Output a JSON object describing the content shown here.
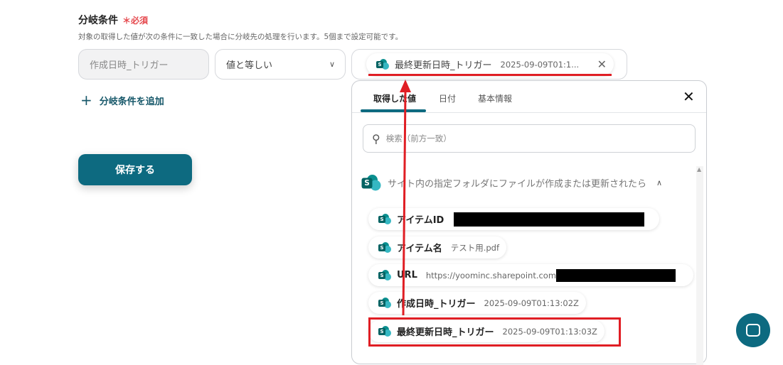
{
  "section": {
    "title": "分岐条件",
    "required": "＊必須",
    "description": "対象の取得した値が次の条件に一致した場合に分岐先の処理を行います。5個まで設定可能です。"
  },
  "condition": {
    "field": "作成日時_トリガー",
    "operator": "値と等しい",
    "value_chip": {
      "name": "最終更新日時_トリガー",
      "value": "2025-09-09T01:1..."
    }
  },
  "add_condition": "分岐条件を追加",
  "save_label": "保存する",
  "popup": {
    "tabs": [
      {
        "label": "取得した値",
        "active": true
      },
      {
        "label": "日付"
      },
      {
        "label": "基本情報"
      }
    ],
    "search_placeholder": "検索（前方一致）",
    "group_title": "サイト内の指定フォルダにファイルが作成または更新されたら",
    "items": [
      {
        "name": "アイテムID",
        "value": ""
      },
      {
        "name": "アイテム名",
        "value": "テスト用.pdf"
      },
      {
        "name": "URL",
        "value": "https://yoominc.sharepoint.com"
      },
      {
        "name": "作成日時_トリガー",
        "value": "2025-09-09T01:13:02Z"
      },
      {
        "name": "最終更新日時_トリガー",
        "value": "2025-09-09T01:13:03Z"
      }
    ]
  },
  "colors": {
    "primary": "#0d6a80",
    "required": "#e5484d",
    "annotation": "#e01e24"
  }
}
